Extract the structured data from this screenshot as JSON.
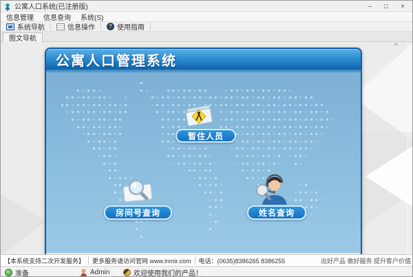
{
  "window": {
    "title": "公寓人口系统(已注册版)",
    "controls": {
      "minimize": "–",
      "maximize": "□",
      "close": "×"
    }
  },
  "menu": {
    "items": [
      {
        "label": "信息管理"
      },
      {
        "label": "信息查询"
      },
      {
        "label": "系统(S)"
      }
    ]
  },
  "toolbar": {
    "items": [
      {
        "label": "系统导航",
        "icon": "monitor-icon"
      },
      {
        "label": "信息操作",
        "icon": "form-icon"
      },
      {
        "label": "使用指南",
        "icon": "help-icon"
      }
    ],
    "help_glyph": "?"
  },
  "tabs": {
    "active": "图文导航"
  },
  "panel": {
    "title": "公寓人口管理系统",
    "buttons": [
      {
        "label": "暂住人员",
        "icon": "folder-person-icon"
      },
      {
        "label": "房间号查询",
        "icon": "magnifier-icon"
      },
      {
        "label": "姓名查询",
        "icon": "operator-icon"
      }
    ]
  },
  "infobar": {
    "support": "【本系统支持二次开发服务】",
    "website": "更多服务请访问官网 www.inmir.com",
    "phone": "电话：(0635)8386265 8386255",
    "slogan": "出好产品 做好服务 提升客户价值"
  },
  "statusbar": {
    "ready": "准备",
    "user": "Admin",
    "welcome": "欢迎使用我们的产品！"
  },
  "colors": {
    "panel_header_start": "#5cb0e6",
    "panel_header_end": "#0f63ad",
    "panel_body": "#8cbede",
    "button_bg": "#1c80d2",
    "button_border": "#d6edfb"
  }
}
